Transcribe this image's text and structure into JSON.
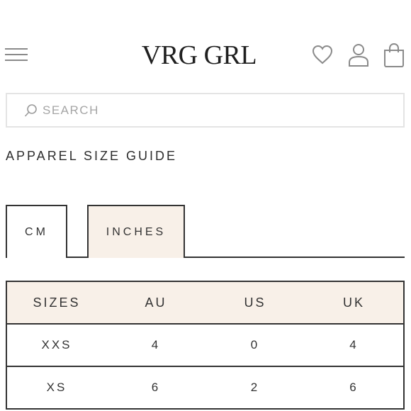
{
  "header": {
    "logo": "VRG GRL",
    "icons": [
      "menu-icon",
      "heart-icon",
      "user-icon",
      "shopping-bag-icon"
    ]
  },
  "search": {
    "placeholder": "SEARCH"
  },
  "page": {
    "title": "APPAREL SIZE GUIDE"
  },
  "tabs": [
    {
      "label": "CM",
      "active": false
    },
    {
      "label": "INCHES",
      "active": true
    }
  ],
  "table": {
    "headers": [
      "SIZES",
      "AU",
      "US",
      "UK"
    ],
    "rows": [
      [
        "XXS",
        "4",
        "0",
        "4"
      ],
      [
        "XS",
        "6",
        "2",
        "6"
      ]
    ]
  },
  "colors": {
    "accent_bg": "#f8f0e8",
    "text": "#333333",
    "border": "#333333",
    "icon": "#8a8a8a"
  }
}
